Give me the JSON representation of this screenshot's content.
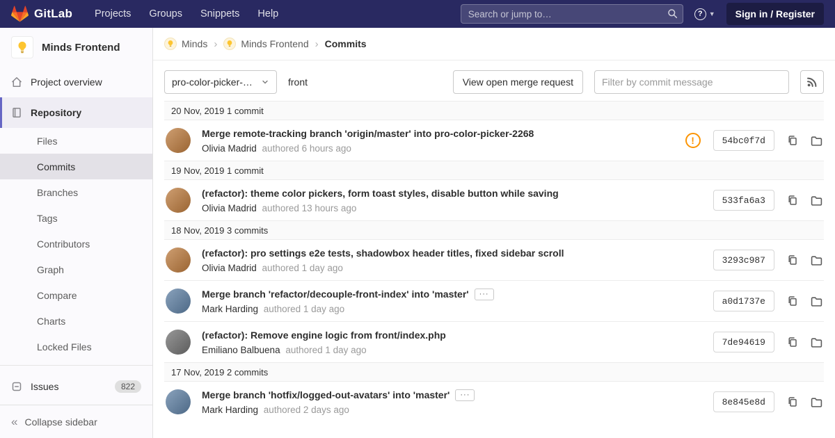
{
  "colors": {
    "navbar_bg": "#292961",
    "accent": "#6666c4",
    "warning": "#fc9403"
  },
  "ui": {
    "chevron": "›",
    "ellipsis": "···",
    "warning": "!",
    "collapse_icon": "«"
  },
  "navbar": {
    "brand": "GitLab",
    "links": [
      {
        "label": "Projects"
      },
      {
        "label": "Groups"
      },
      {
        "label": "Snippets"
      },
      {
        "label": "Help"
      }
    ],
    "search_placeholder": "Search or jump to…",
    "help": "?",
    "sign_in": "Sign in / Register"
  },
  "sidebar": {
    "project": {
      "name": "Minds Frontend"
    },
    "overview": "Project overview",
    "section": "Repository",
    "repo_items": [
      "Files",
      "Commits",
      "Branches",
      "Tags",
      "Contributors",
      "Graph",
      "Compare",
      "Charts",
      "Locked Files"
    ],
    "issues": {
      "label": "Issues",
      "count": "822"
    },
    "collapse": "Collapse sidebar"
  },
  "breadcrumb": {
    "crumbs": [
      "Minds",
      "Minds Frontend",
      "Commits"
    ]
  },
  "controls": {
    "branch": "pro-color-picker-…",
    "ref": "front",
    "view_mr": "View open merge request",
    "filter_placeholder": "Filter by commit message"
  },
  "feed": {
    "groups": [
      {
        "date": "20 Nov, 2019 1 commit",
        "commits": [
          {
            "title": "Merge remote-tracking branch 'origin/master' into pro-color-picker-2268",
            "author": "Olivia Madrid",
            "meta": "authored 6 hours ago",
            "sha": "54bc0f7d",
            "avatar": "#bc7a3c"
          }
        ]
      },
      {
        "date": "19 Nov, 2019 1 commit",
        "commits": [
          {
            "title": "(refactor): theme color pickers, form toast styles, disable button while saving",
            "author": "Olivia Madrid",
            "meta": "authored 13 hours ago",
            "sha": "533fa6a3",
            "avatar": "#bc7a3c"
          }
        ]
      },
      {
        "date": "18 Nov, 2019 3 commits",
        "commits": [
          {
            "title": "(refactor): pro settings e2e tests, shadowbox header titles, fixed sidebar scroll",
            "author": "Olivia Madrid",
            "meta": "authored 1 day ago",
            "sha": "3293c987",
            "avatar": "#bc7a3c"
          },
          {
            "title": "Merge branch 'refactor/decouple-front-index' into 'master'",
            "author": "Mark Harding",
            "meta": "authored 1 day ago",
            "sha": "a0d1737e",
            "avatar": "#5d7fa3"
          },
          {
            "title": "(refactor): Remove engine logic from front/index.php",
            "author": "Emiliano Balbuena",
            "meta": "authored 1 day ago",
            "sha": "7de94619",
            "avatar": "#707070"
          }
        ]
      },
      {
        "date": "17 Nov, 2019 2 commits",
        "commits": [
          {
            "title": "Merge branch 'hotfix/logged-out-avatars' into 'master'",
            "author": "Mark Harding",
            "meta": "authored 2 days ago",
            "sha": "8e845e8d",
            "avatar": "#5d7fa3"
          }
        ]
      }
    ]
  }
}
